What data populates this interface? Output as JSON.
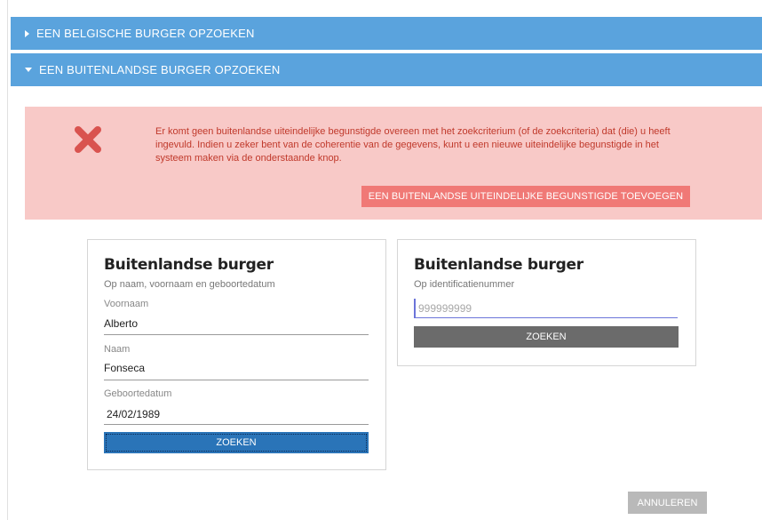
{
  "accordion": {
    "belgian": {
      "label": "EEN BELGISCHE BURGER OPZOEKEN"
    },
    "foreign": {
      "label": "EEN BUITENLANDSE BURGER OPZOEKEN"
    }
  },
  "alert": {
    "icon": "close-icon",
    "message": "Er komt geen buitenlandse uiteindelijke begunstigde overeen met het zoekcriterium (of de zoekcriteria) dat (die) u heeft ingevuld. Indien u zeker bent van de coherentie van de gegevens, kunt u een nieuwe uiteindelijke begunstigde in het systeem maken via de onderstaande knop.",
    "button_label": "EEN BUITENLANDSE UITEINDELIJKE BEGUNSTIGDE TOEVOEGEN"
  },
  "search_by_name": {
    "title": "Buitenlandse burger",
    "subtitle": "Op naam, voornaam en geboortedatum",
    "first_name": {
      "label": "Voornaam",
      "value": "Alberto"
    },
    "last_name": {
      "label": "Naam",
      "value": "Fonseca"
    },
    "birth_date": {
      "label": "Geboortedatum",
      "value": "24/02/1989"
    },
    "search_label": "ZOEKEN"
  },
  "search_by_id": {
    "title": "Buitenlandse burger",
    "subtitle": "Op identificatienummer",
    "id_placeholder": "999999999",
    "id_value": "",
    "search_label": "ZOEKEN"
  },
  "footer": {
    "cancel_label": "ANNULEREN"
  },
  "colors": {
    "accordion": "#5aa3dd",
    "alert_bg": "#f8c9c7",
    "alert_text": "#c0392b",
    "alert_button": "#f07976",
    "primary_button": "#2a74b8",
    "secondary_button": "#6b6b6b",
    "cancel_button": "#b9b9b9"
  }
}
